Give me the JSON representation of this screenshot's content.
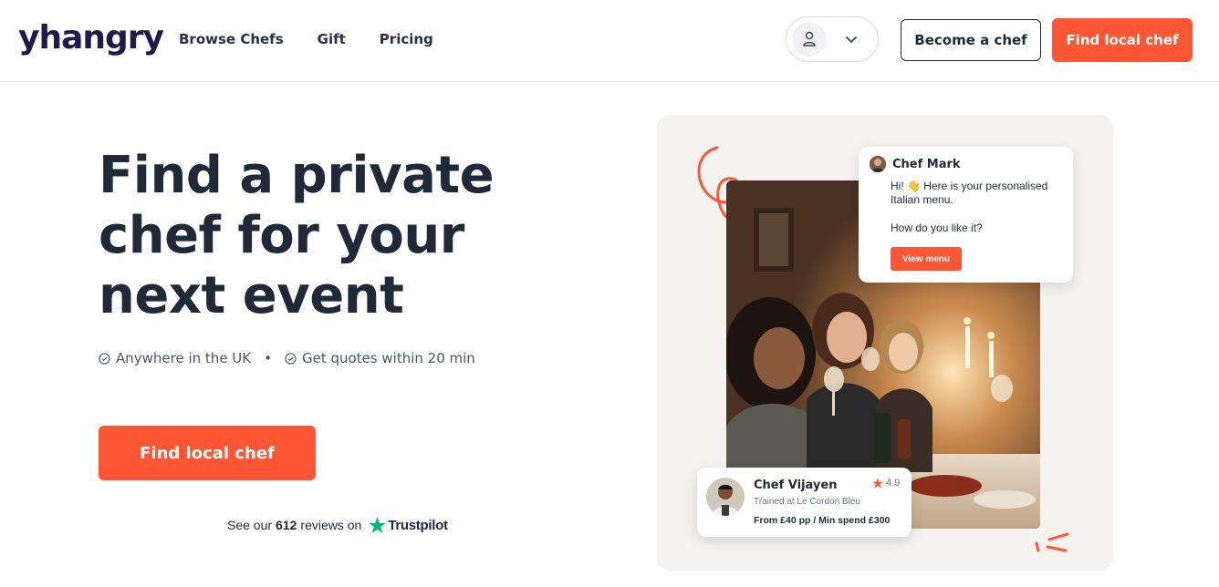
{
  "header": {
    "logo": "yhangry",
    "nav": [
      "Browse Chefs",
      "Gift",
      "Pricing"
    ],
    "become_chef": "Become a chef",
    "find_chef": "Find local chef"
  },
  "hero": {
    "title": "Find a private chef for your next event",
    "features": [
      "Anywhere in the UK",
      "Get quotes within 20 min"
    ],
    "bullet": "•",
    "cta": "Find local chef",
    "reviews_prefix": "See our",
    "reviews_count": "612",
    "reviews_suffix": "reviews on",
    "trustpilot": "Trustpilot"
  },
  "chat_card": {
    "name": "Chef Mark",
    "message_1": "Hi! 👋 Here is your personalised Italian menu.",
    "message_2": "How do you like it?",
    "button": "View menu"
  },
  "chef_card": {
    "name": "Chef Vijayen",
    "rating": "4.9",
    "trained": "Trained at Le Cordon Bleu",
    "price": "From £40 pp / Min spend £300"
  },
  "colors": {
    "accent": "#fd5635",
    "text": "#1f2937",
    "logo": "#1e1b4b",
    "trustpilot_star": "#00b67a",
    "panel_bg": "#f5f3f0"
  },
  "icons": [
    "user-icon",
    "chevron-down-icon",
    "check-circle-icon",
    "trustpilot-star-icon",
    "star-icon"
  ]
}
